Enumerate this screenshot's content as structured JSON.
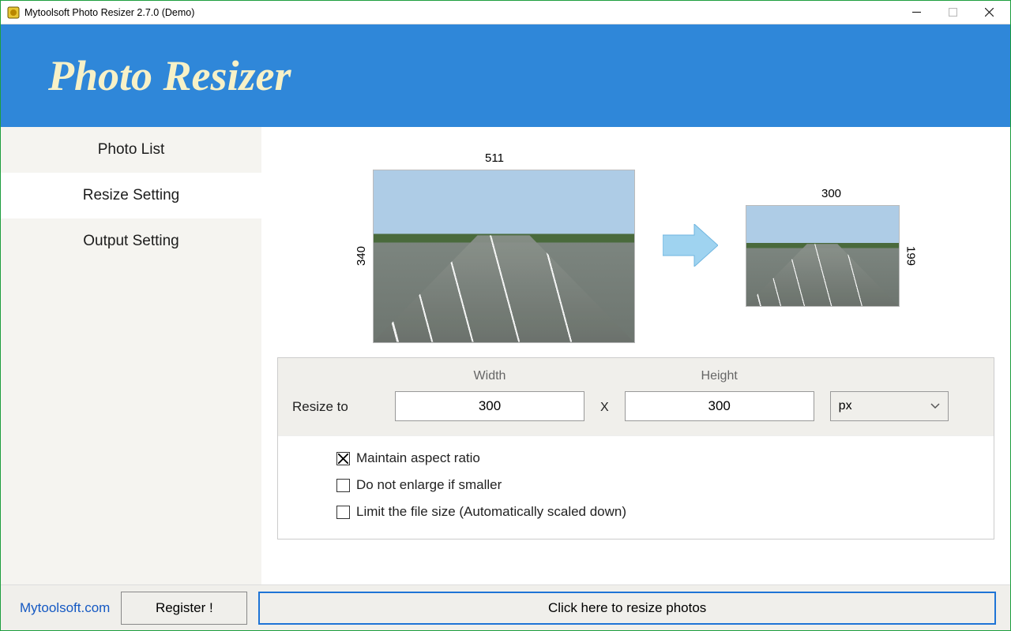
{
  "window": {
    "title": "Mytoolsoft Photo Resizer 2.7.0 (Demo)"
  },
  "banner": {
    "title": "Photo Resizer"
  },
  "sidebar": {
    "tabs": [
      {
        "label": "Photo List"
      },
      {
        "label": "Resize Setting"
      },
      {
        "label": "Output Setting"
      }
    ],
    "active_index": 1
  },
  "preview": {
    "source": {
      "width": "511",
      "height": "340"
    },
    "target": {
      "width": "300",
      "height": "199"
    }
  },
  "form": {
    "resize_label": "Resize to",
    "width_label": "Width",
    "height_label": "Height",
    "width_value": "300",
    "height_value": "300",
    "separator": "X",
    "unit": "px",
    "checks": [
      {
        "label": "Maintain aspect ratio",
        "checked": true
      },
      {
        "label": "Do not enlarge if smaller",
        "checked": false
      },
      {
        "label": "Limit the file size (Automatically scaled down)",
        "checked": false
      }
    ]
  },
  "footer": {
    "link": "Mytoolsoft.com",
    "register": "Register !",
    "resize": "Click here to resize photos"
  }
}
